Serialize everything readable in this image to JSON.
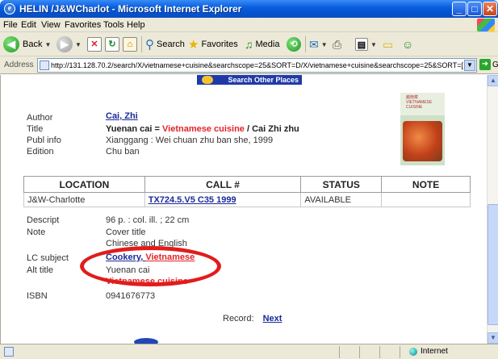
{
  "window": {
    "title": "HELIN /J&WCharlot - Microsoft Internet Explorer",
    "min": "_",
    "max": "□",
    "close": "✕"
  },
  "menu": [
    "File",
    "Edit",
    "View",
    "Favorites",
    "Tools",
    "Help"
  ],
  "toolbar": {
    "back": "Back",
    "search": "Search",
    "favorites": "Favorites",
    "media": "Media"
  },
  "address": {
    "label": "Address",
    "url": "http://131.128.70.2/search/X/vietnamese+cuisine&searchscope=25&SORT=D/X/vietnamese+cuisine&searchscope=25&SORT=[",
    "go": "Go"
  },
  "page": {
    "search_other": "Search Other Places",
    "author_label": "Author",
    "author_value": "Cai, Zhi",
    "title_label": "Title",
    "title_part1": "Yuenan cai = ",
    "title_part2": "Vietnamese cuisine",
    "title_part3": " / Cai Zhi zhu",
    "publ_label": "Publ info",
    "publ_value": "Xianggang : Wei chuan zhu ban she, 1999",
    "edition_label": "Edition",
    "edition_value": "Chu ban",
    "cover_text": "越南菜 VIETNAMESE CUISINE",
    "table": {
      "headers": [
        "LOCATION",
        "CALL #",
        "STATUS",
        "NOTE"
      ],
      "rows": [
        [
          "J&W-Charlotte",
          "TX724.5.V5 C35 1999",
          "AVAILABLE",
          ""
        ]
      ]
    },
    "descript_label": "Descript",
    "descript_value": "96 p. : col. ill. ; 22 cm",
    "note_label": "Note",
    "note_value1": "Cover title",
    "note_value2": "Chinese and English",
    "lc_label": "LC subject",
    "lc_value1": "Cookery, ",
    "lc_value2": "Vietnamese",
    "alt_label": "Alt title",
    "alt_value1": "Yuenan cai",
    "alt_value2": "Vietnamese cuisine",
    "isbn_label": "ISBN",
    "isbn_value": "0941676773",
    "record_label": "Record:",
    "record_next": "Next"
  },
  "status": {
    "zone": "Internet"
  }
}
